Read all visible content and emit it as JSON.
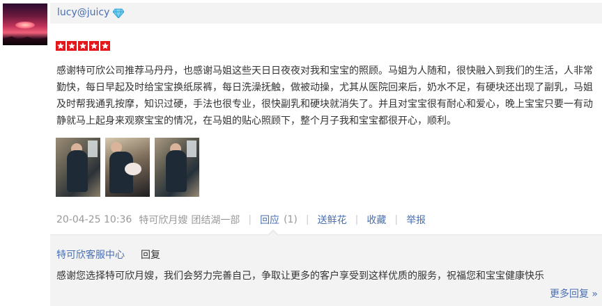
{
  "user": {
    "name": "lucy@juicy",
    "badge_icon": "diamond-icon"
  },
  "rating": {
    "stars": 5,
    "max": 5,
    "color": "#e4161b"
  },
  "review": {
    "text": "感谢特可欣公司推荐马丹丹，也感谢马姐这些天日日夜夜对我和宝宝的照顾。马姐为人随和，很快融入到我们的生活，人非常勤快，每日早起及时给宝宝换纸尿裤，每日洗澡抚触，做被动操，尤其从医院回来后，奶水不足，有硬块还出现了副乳，马姐及时帮我通乳按摩，知识过硬，手法也很专业，很快副乳和硬块就消失了。并且对宝宝很有耐心和爱心，晚上宝宝只要一有动静就马上起身来观察宝宝的情况，在马姐的贴心照顾下，整个月子我和宝宝都很开心，顺利。",
    "photo_count": 3
  },
  "meta": {
    "datetime": "20-04-25 10:36",
    "service": "特可欣月嫂",
    "location": "团结湖一部",
    "reply_label": "回应",
    "reply_count": "(1)",
    "flower_label": "送鲜花",
    "favorite_label": "收藏",
    "report_label": "举报"
  },
  "reply": {
    "author": "特可欣客服中心",
    "action_label": "回复",
    "text": "感谢您选择特可欣月嫂，我们会努力完善自己，争取让更多的客户享受到这样优质的服务，祝福您和宝宝健康快乐",
    "more_label": "更多回复 »"
  },
  "colors": {
    "link": "#4a6fb0",
    "muted": "#999999",
    "panel": "#f3f3f3"
  }
}
